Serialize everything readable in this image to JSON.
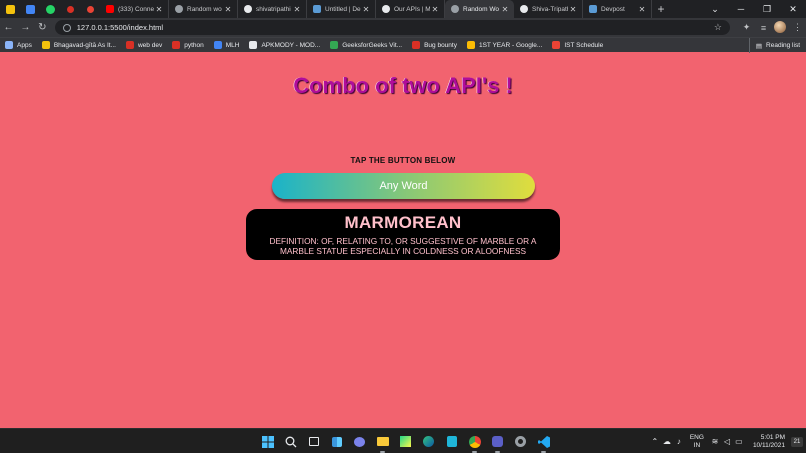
{
  "browser": {
    "tabs": [
      {
        "title": "(333) Conne",
        "favicon_color": "#ff0000"
      },
      {
        "title": "Random wo",
        "favicon_color": "#9aa0a6"
      },
      {
        "title": "shivatripathi",
        "favicon_color": "#e8eaed"
      },
      {
        "title": "Untitled | De",
        "favicon_color": "#5b9bd5"
      },
      {
        "title": "Our APIs | M",
        "favicon_color": "#e8eaed"
      },
      {
        "title": "Random Wo",
        "favicon_color": "#9aa0a6",
        "active": true
      },
      {
        "title": "Shiva-Tripath",
        "favicon_color": "#e8eaed"
      },
      {
        "title": "Devpost",
        "favicon_color": "#5b9bd5"
      }
    ],
    "new_tab_label": "+",
    "url": "127.0.0.1:5500/index.html",
    "bookmarks": [
      {
        "label": "Apps",
        "color": "#8ab4f8"
      },
      {
        "label": "Bhagavad-gītā As It...",
        "color": "#f4c20d"
      },
      {
        "label": "web dev",
        "color": "#d93025"
      },
      {
        "label": "python",
        "color": "#d93025"
      },
      {
        "label": "MLH",
        "color": "#4285f4"
      },
      {
        "label": "APKMODY - MOD...",
        "color": "#e8eaed"
      },
      {
        "label": "GeeksforGeeks Vit...",
        "color": "#34a853"
      },
      {
        "label": "Bug bounty",
        "color": "#d93025"
      },
      {
        "label": "1ST YEAR - Google...",
        "color": "#fbbc04"
      },
      {
        "label": "IST Schedule",
        "color": "#ea4335"
      }
    ],
    "reading_list_label": "Reading list"
  },
  "page": {
    "title": "Combo of two API's !",
    "instruction": "TAP THE BUTTON BELOW",
    "button_label": "Any Word",
    "word": "MARMOREAN",
    "definition": "DEFINITION: OF, RELATING TO, OR SUGGESTIVE OF MARBLE OR A MARBLE STATUE ESPECIALLY IN COLDNESS OR ALOOFNESS"
  },
  "taskbar": {
    "lang_line1": "ENG",
    "lang_line2": "IN",
    "time": "5:01 PM",
    "date": "10/11/2021",
    "notification_count": "21"
  },
  "colors": {
    "page_background": "#f2636f",
    "title": "#b00d9a",
    "card_background": "#000000",
    "card_text": "#ffc0cb"
  }
}
